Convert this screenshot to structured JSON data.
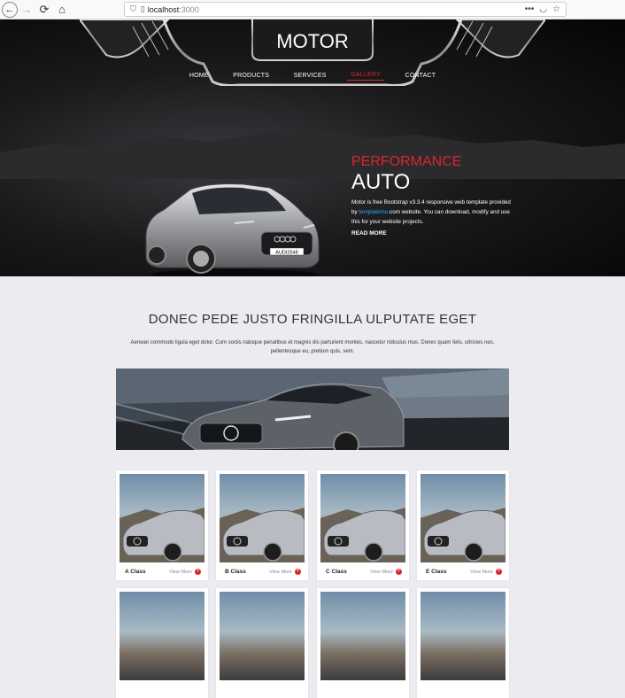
{
  "browser": {
    "back_icon": "arrow-left",
    "forward_icon": "arrow-right",
    "reload_icon": "reload",
    "home_icon": "home",
    "url_host": "localhost",
    "url_port": ":3000",
    "menu_label": "•••"
  },
  "site": {
    "logo": "MOTOR",
    "nav": [
      "HOME",
      "PRODUCTS",
      "SERVICES",
      "GALLERY",
      "CONTACT"
    ],
    "active_nav": "GALLERY"
  },
  "hero": {
    "kicker": "PERFORMANCE",
    "title": "AUTO",
    "desc_1": "Motor is free Bootstrap v3.3.4 responsive web template provided by ",
    "desc_link": "templatemo",
    "desc_2": ".com website. You can download, modify and use this for your website projects.",
    "cta": "READ MORE",
    "plate": "AUDI2548"
  },
  "section": {
    "title": "DONEC PEDE JUSTO FRINGILLA ULPUTATE EGET",
    "text": "Aenean commodo ligula eget dolor. Cum sociis natoque penatibus et magnis dis parturient montes, nascetur ridiculus mus. Donec quam felis, ultricies nec, pellentesque eu, pretium quis, sem."
  },
  "cards": [
    {
      "name": "A Class",
      "more": "View More"
    },
    {
      "name": "B Class",
      "more": "View More"
    },
    {
      "name": "C Class",
      "more": "View More"
    },
    {
      "name": "E Class",
      "more": "View More"
    }
  ],
  "colors": {
    "accent": "#d9262d",
    "link": "#2aa8ff",
    "page_bg": "#ecebf0"
  }
}
